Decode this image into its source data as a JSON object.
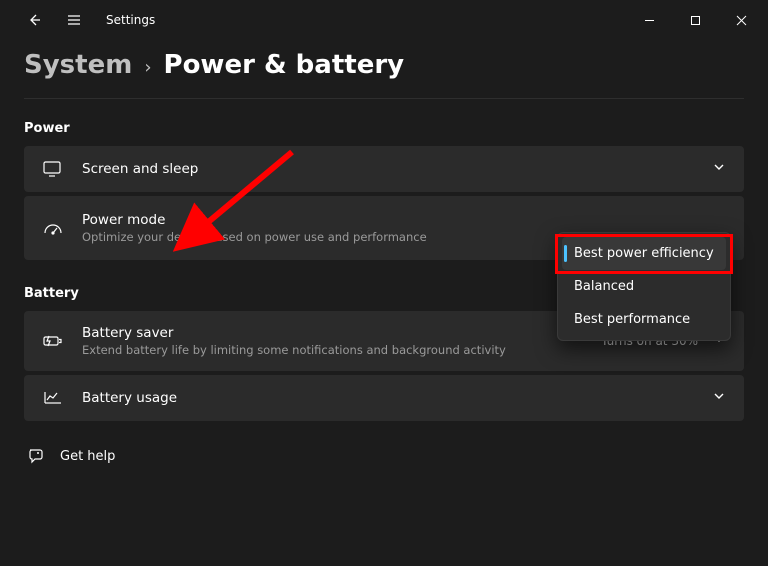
{
  "window": {
    "title": "Settings"
  },
  "breadcrumb": {
    "parent": "System",
    "separator": "›",
    "current": "Power & battery"
  },
  "sections": {
    "power_header": "Power",
    "battery_header": "Battery"
  },
  "rows": {
    "screen_sleep": {
      "title": "Screen and sleep"
    },
    "power_mode": {
      "title": "Power mode",
      "subtitle": "Optimize your device based on power use and performance"
    },
    "battery_saver": {
      "title": "Battery saver",
      "subtitle": "Extend battery life by limiting some notifications and background activity",
      "trailing": "Turns on at 30%"
    },
    "battery_usage": {
      "title": "Battery usage"
    }
  },
  "dropdown": {
    "options": [
      "Best power efficiency",
      "Balanced",
      "Best performance"
    ],
    "selected_index": 0
  },
  "help": {
    "label": "Get help"
  },
  "colors": {
    "bg": "#1c1c1c",
    "row_bg": "#2b2b2b",
    "accent": "#4cc2ff",
    "annotation": "#ff0000"
  }
}
